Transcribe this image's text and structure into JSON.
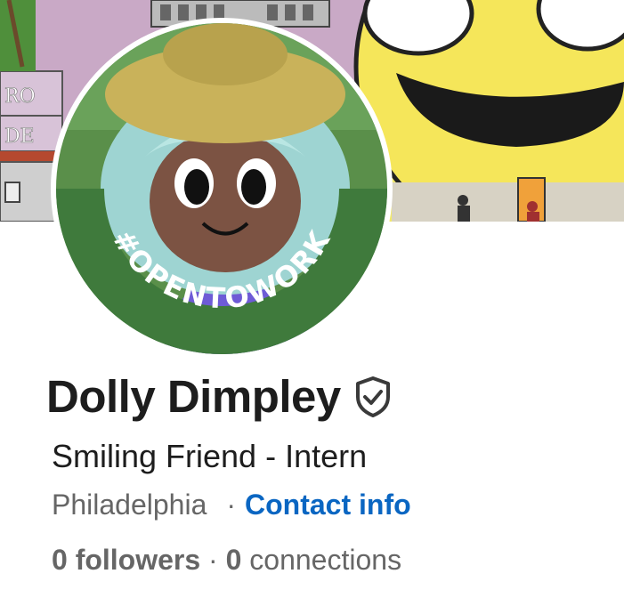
{
  "profile": {
    "name": "Dolly Dimpley",
    "headline": "Smiling Friend - Intern",
    "location": "Philadelphia",
    "separator": "·",
    "contact_link": "Contact info",
    "followers_count": "0",
    "followers_label": "followers",
    "connections_count": "0",
    "connections_label": "connections",
    "open_to_work_badge": "#OPENTOWORK"
  },
  "banner_text": {
    "sign_line1": "RO",
    "sign_line2": "DE"
  },
  "icons": {
    "verified": "shield-check-icon"
  },
  "colors": {
    "open_to_work_ring": "#3f7a3c",
    "link": "#0a66c2",
    "banner_smiley": "#f5e65a",
    "banner_building": "#c9a9c6"
  }
}
